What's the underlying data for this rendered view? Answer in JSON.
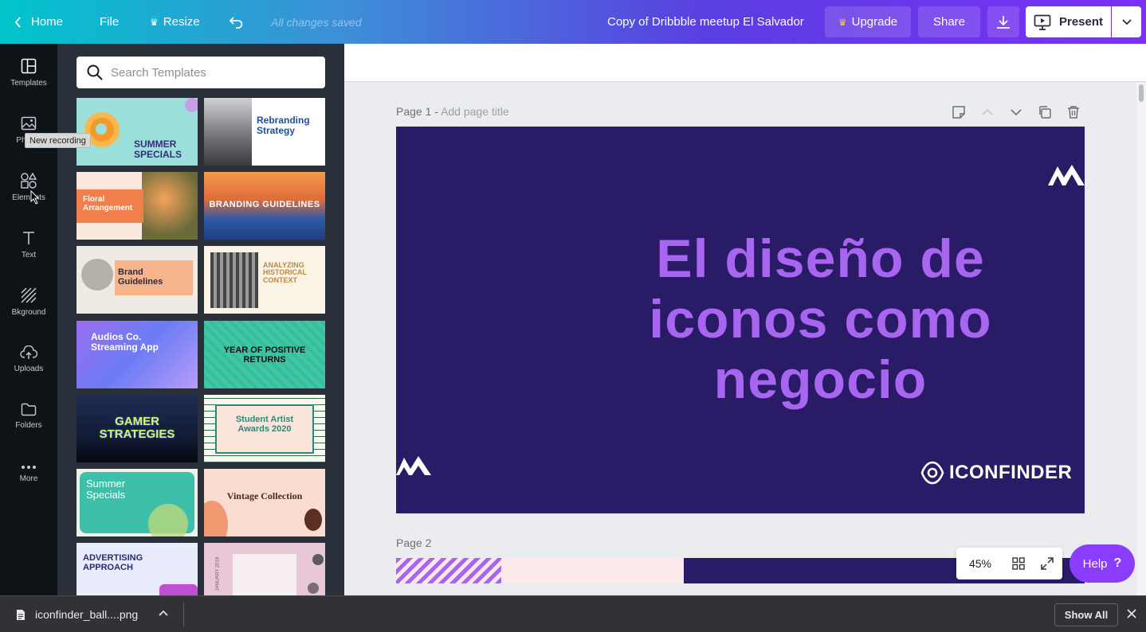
{
  "topbar": {
    "home": "Home",
    "file": "File",
    "resize": "Resize",
    "saved": "All changes saved",
    "title": "Copy of Dribbble meetup El Salvador",
    "upgrade": "Upgrade",
    "share": "Share",
    "present": "Present"
  },
  "rail": {
    "items": [
      "Templates",
      "Photos",
      "Elements",
      "Text",
      "Bkground",
      "Uploads",
      "Folders",
      "More"
    ],
    "tooltip": "New recording"
  },
  "panel": {
    "search_placeholder": "Search Templates",
    "templates": [
      {
        "label": "SUMMER SPECIALS"
      },
      {
        "label": "Rebranding Strategy"
      },
      {
        "label": "Floral Arrangement"
      },
      {
        "label": "BRANDING GUIDELINES"
      },
      {
        "label": "Brand Guidelines"
      },
      {
        "label": "ANALYZING HISTORICAL CONTEXT"
      },
      {
        "label": "Audios Co. Streaming App"
      },
      {
        "label": "YEAR OF POSITIVE RETURNS"
      },
      {
        "label": "GAMER STRATEGIES"
      },
      {
        "label": "Student Artist Awards 2020"
      },
      {
        "label": "Summer Specials"
      },
      {
        "label": "Vintage Collection"
      },
      {
        "label": "ADVERTISING APPROACH"
      },
      {
        "label": "JANUARY 2019"
      }
    ]
  },
  "canvas": {
    "page1_label": "Page 1 -",
    "page1_title_placeholder": "Add page title",
    "slide_title": "El diseño de iconos como negocio",
    "brand": "ICONFINDER",
    "page2_label": "Page 2"
  },
  "zoom": {
    "value": "45%"
  },
  "help": {
    "label": "Help",
    "icon": "?"
  },
  "download_bar": {
    "file": "iconfinder_ball....png",
    "show_all": "Show All"
  },
  "colors": {
    "slide_bg": "#2a1b67",
    "slide_title": "#a765f0",
    "accent": "#8b3dff"
  }
}
